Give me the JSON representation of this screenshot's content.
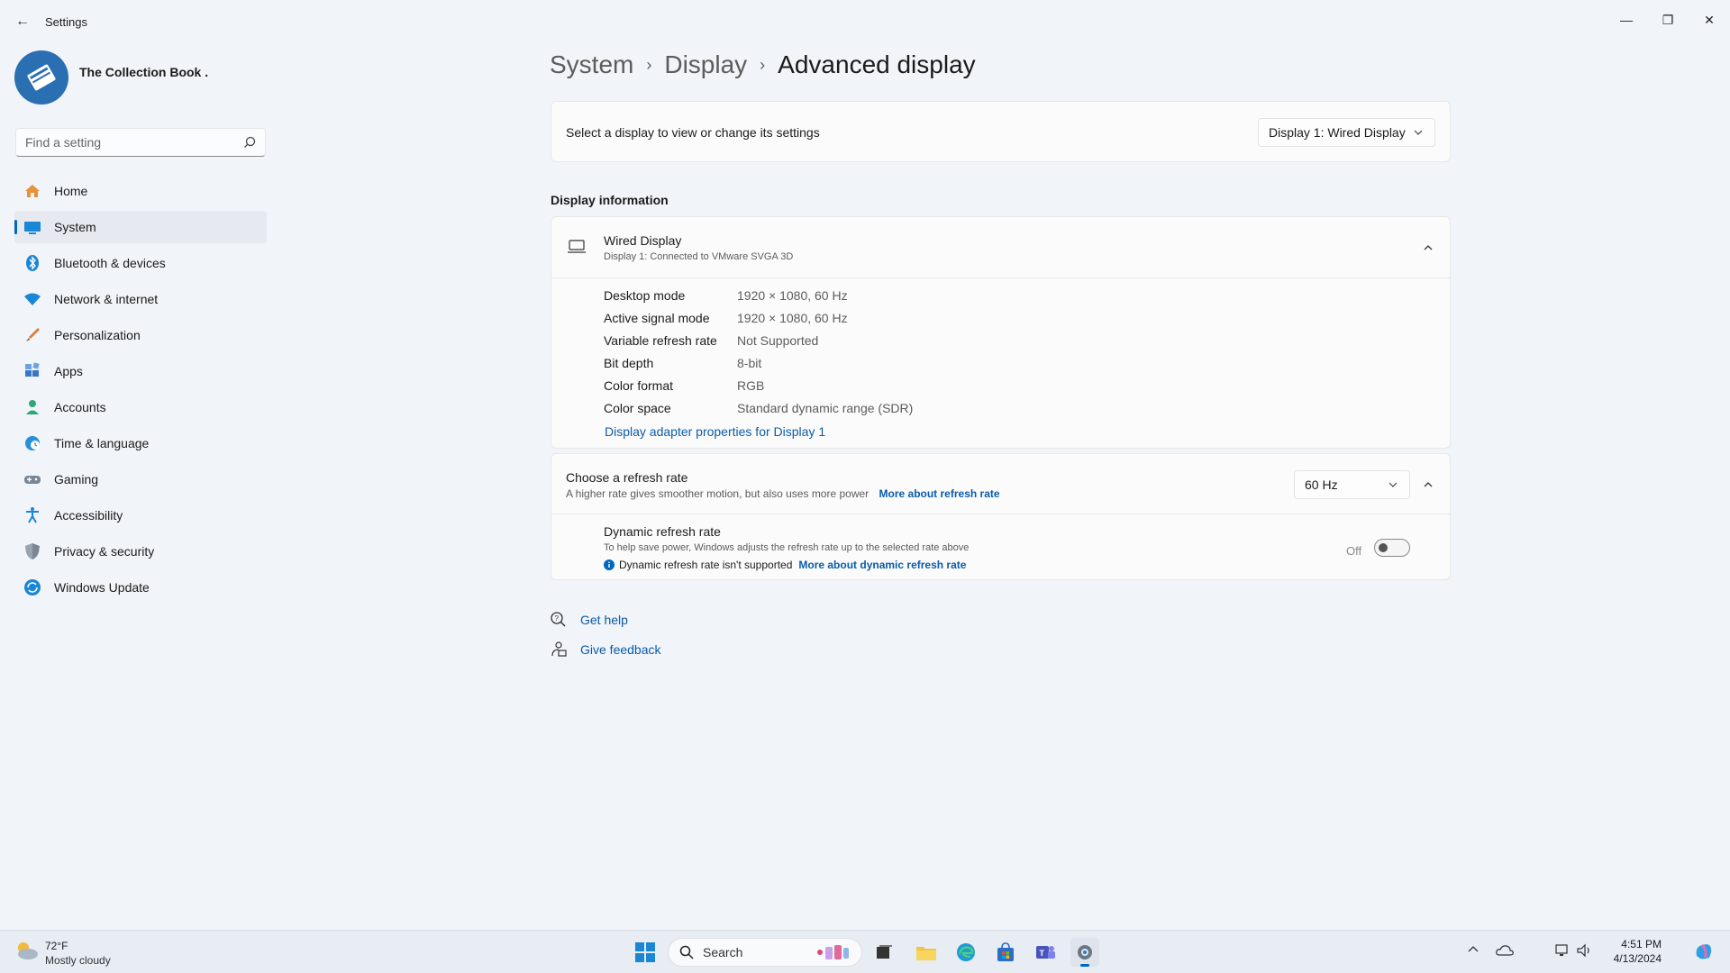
{
  "window": {
    "title": "Settings",
    "back_glyph": "←",
    "minimize_glyph": "—",
    "maximize_glyph": "❐",
    "close_glyph": "✕"
  },
  "profile": {
    "name": "The Collection Book ."
  },
  "search": {
    "placeholder": "Find a setting"
  },
  "sidebar": {
    "items": [
      {
        "label": "Home",
        "icon": "home-icon"
      },
      {
        "label": "System",
        "icon": "monitor-icon",
        "active": true
      },
      {
        "label": "Bluetooth & devices",
        "icon": "bluetooth-icon"
      },
      {
        "label": "Network & internet",
        "icon": "wifi-icon"
      },
      {
        "label": "Personalization",
        "icon": "brush-icon"
      },
      {
        "label": "Apps",
        "icon": "apps-icon"
      },
      {
        "label": "Accounts",
        "icon": "person-icon"
      },
      {
        "label": "Time & language",
        "icon": "globe-clock-icon"
      },
      {
        "label": "Gaming",
        "icon": "gamepad-icon"
      },
      {
        "label": "Accessibility",
        "icon": "accessibility-icon"
      },
      {
        "label": "Privacy & security",
        "icon": "shield-icon"
      },
      {
        "label": "Windows Update",
        "icon": "update-icon"
      }
    ]
  },
  "breadcrumb": {
    "level1": "System",
    "level2": "Display",
    "current": "Advanced display",
    "sep": "›"
  },
  "select_display": {
    "label": "Select a display to view or change its settings",
    "value": "Display 1: Wired Display"
  },
  "display_info": {
    "heading": "Display information",
    "name": "Wired Display",
    "subtitle": "Display 1: Connected to VMware SVGA 3D",
    "rows": [
      {
        "label": "Desktop mode",
        "value": "1920 × 1080, 60 Hz"
      },
      {
        "label": "Active signal mode",
        "value": "1920 × 1080, 60 Hz"
      },
      {
        "label": "Variable refresh rate",
        "value": "Not Supported"
      },
      {
        "label": "Bit depth",
        "value": "8-bit"
      },
      {
        "label": "Color format",
        "value": "RGB"
      },
      {
        "label": "Color space",
        "value": "Standard dynamic range (SDR)"
      }
    ],
    "adapter_link": "Display adapter properties for Display 1"
  },
  "refresh": {
    "title": "Choose a refresh rate",
    "desc": "A higher rate gives smoother motion, but also uses more power",
    "more_link": "More about refresh rate",
    "value": "60 Hz",
    "dynamic_title": "Dynamic refresh rate",
    "dynamic_desc": "To help save power, Windows adjusts the refresh rate up to the selected rate above",
    "dynamic_note": "Dynamic refresh rate isn't supported",
    "dynamic_more_link": "More about dynamic refresh rate",
    "toggle_state": "Off"
  },
  "help": {
    "get_help": "Get help",
    "feedback": "Give feedback"
  },
  "taskbar": {
    "weather_temp": "72°F",
    "weather_desc": "Mostly cloudy",
    "search_label": "Search",
    "time": "4:51 PM",
    "date": "4/13/2024"
  },
  "colors": {
    "accent": "#0067c0",
    "link": "#0a5ca8",
    "background": "#f1f4f9"
  }
}
